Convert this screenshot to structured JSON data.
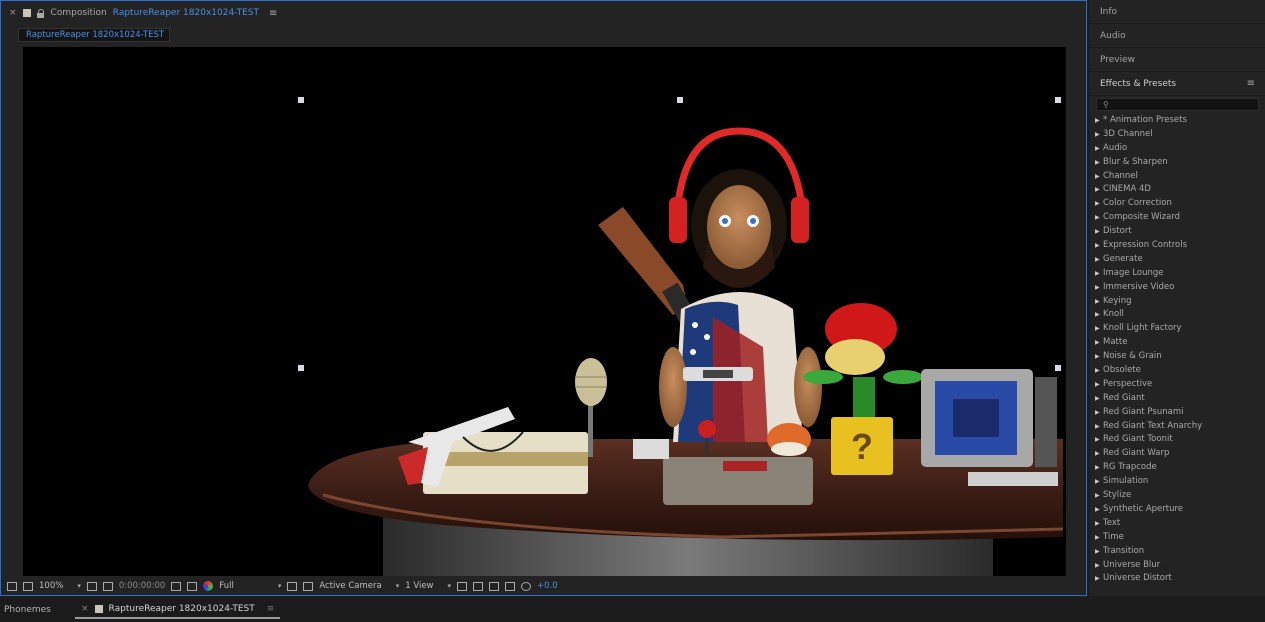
{
  "composition": {
    "close_glyph": "×",
    "title_prefix": "Composition",
    "title_name": "RaptureReaper 1820x1024-TEST",
    "tab_label": "RaptureReaper 1820x1024-TEST"
  },
  "toolbar": {
    "zoom": "100%",
    "timecode": "0:00:00:00",
    "resolution": "Full",
    "camera": "Active Camera",
    "views": "1 View",
    "exposure": "+0.0"
  },
  "side_tabs": [
    "Info",
    "Audio",
    "Preview"
  ],
  "effects": {
    "title": "Effects & Presets",
    "search_placeholder": "",
    "items": [
      "* Animation Presets",
      "3D Channel",
      "Audio",
      "Blur & Sharpen",
      "Channel",
      "CINEMA 4D",
      "Color Correction",
      "Composite Wizard",
      "Distort",
      "Expression Controls",
      "Generate",
      "Image Lounge",
      "Immersive Video",
      "Keying",
      "Knoll",
      "Knoll Light Factory",
      "Matte",
      "Noise & Grain",
      "Obsolete",
      "Perspective",
      "Red Giant",
      "Red Giant Psunami",
      "Red Giant Text Anarchy",
      "Red Giant Toonit",
      "Red Giant Warp",
      "RG Trapcode",
      "Simulation",
      "Stylize",
      "Synthetic Aperture",
      "Text",
      "Time",
      "Transition",
      "Universe Blur",
      "Universe Distort"
    ]
  },
  "bottom": {
    "phonemes_tab": "Phonemes",
    "timeline_tab": "RaptureReaper 1820x1024-TEST"
  },
  "colors": {
    "accent_blue": "#4a90e8",
    "panel_bg": "#232323",
    "viewer_bg": "#000000"
  }
}
